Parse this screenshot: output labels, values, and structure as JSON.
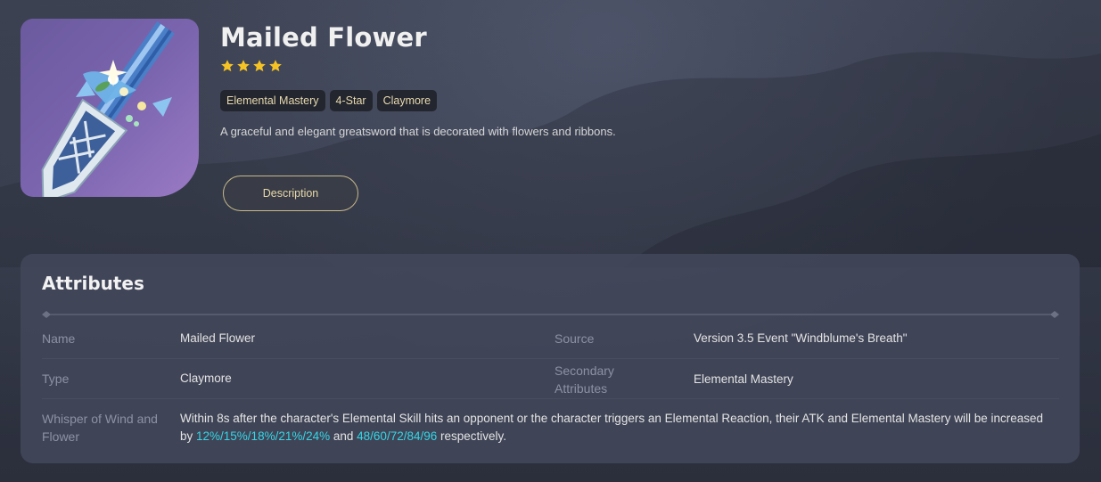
{
  "weapon": {
    "name": "Mailed Flower",
    "rarity_stars": 4,
    "tags": [
      "Elemental Mastery",
      "4-Star",
      "Claymore"
    ],
    "description": "A graceful and elegant greatsword that is decorated with flowers and ribbons.",
    "description_button_label": "Description"
  },
  "attributes": {
    "title": "Attributes",
    "name_label": "Name",
    "name_value": "Mailed Flower",
    "source_label": "Source",
    "source_value": "Version 3.5 Event \"Windblume's Breath\"",
    "type_label": "Type",
    "type_value": "Claymore",
    "secondary_label_line1": "Secondary",
    "secondary_label_line2": "Attributes",
    "secondary_value": "Elemental Mastery",
    "passive_label_line1": "Whisper of Wind and",
    "passive_label_line2": "Flower",
    "passive_text_1": "Within 8s after the character's Elemental Skill hits an opponent or the character triggers an Elemental Reaction, their ATK and Elemental Mastery will be increased",
    "passive_text_2a": "by ",
    "passive_highlight_1": "12%/15%/18%/21%/24%",
    "passive_text_2b": " and ",
    "passive_highlight_2": "48/60/72/84/96",
    "passive_text_2c": " respectively."
  },
  "colors": {
    "star": "#f6c325",
    "tag_text": "#e8d9b0",
    "highlight": "#35d6e6",
    "button_border": "#c7b98a"
  },
  "icons": [
    "claymore-weapon-icon",
    "star-icon"
  ]
}
